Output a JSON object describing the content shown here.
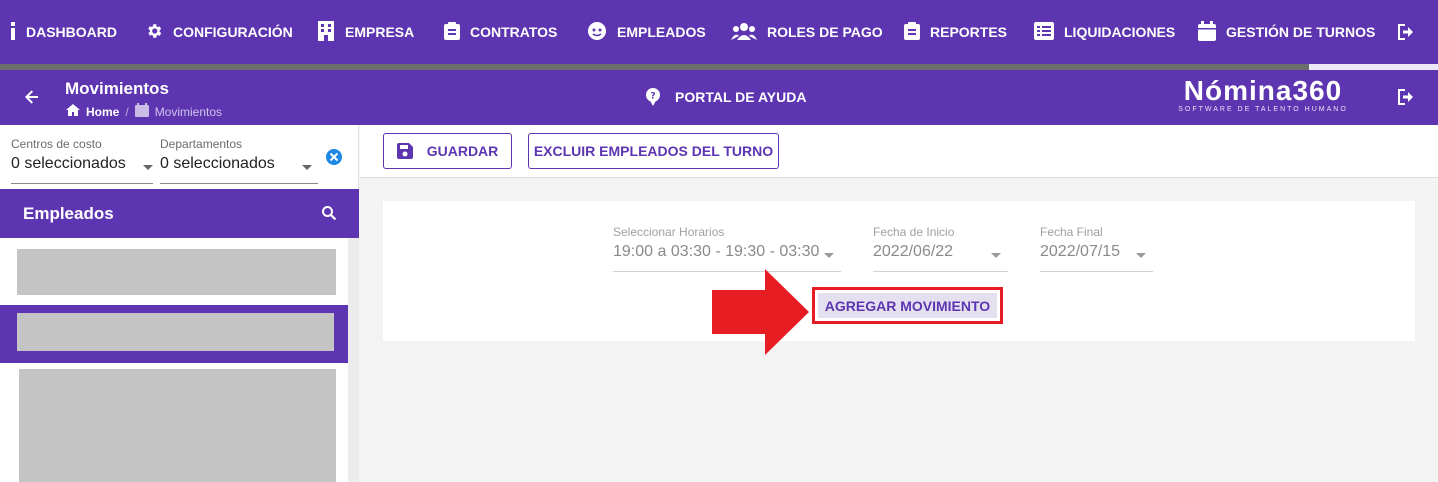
{
  "nav": {
    "items": [
      {
        "label": "DASHBOARD",
        "icon": "info-icon"
      },
      {
        "label": "CONFIGURACIÓN",
        "icon": "gear-icon"
      },
      {
        "label": "EMPRESA",
        "icon": "building-icon"
      },
      {
        "label": "CONTRATOS",
        "icon": "clipboard-icon"
      },
      {
        "label": "EMPLEADOS",
        "icon": "face-icon"
      },
      {
        "label": "ROLES DE PAGO",
        "icon": "people-icon"
      },
      {
        "label": "REPORTES",
        "icon": "clipboard-icon"
      },
      {
        "label": "LIQUIDACIONES",
        "icon": "list-icon"
      },
      {
        "label": "GESTIÓN DE TURNOS",
        "icon": "calendar-icon"
      }
    ],
    "logout_icon": "logout-icon",
    "progress_fraction": 0.91
  },
  "header": {
    "title": "Movimientos",
    "breadcrumb_home": "Home",
    "breadcrumb_sep": "/",
    "breadcrumb_current": "Movimientos",
    "help_label": "PORTAL DE AYUDA",
    "brand_name": "Nómina360",
    "brand_tagline": "SOFTWARE DE TALENTO HUMANO"
  },
  "sidebar": {
    "filters": [
      {
        "label": "Centros de costo",
        "value": "0 seleccionados"
      },
      {
        "label": "Departamentos",
        "value": "0 seleccionados"
      }
    ],
    "employees_title": "Empleados"
  },
  "toolbar": {
    "save_label": "GUARDAR",
    "exclude_label": "EXCLUIR EMPLEADOS DEL TURNO"
  },
  "form": {
    "schedule": {
      "label": "Seleccionar Horarios",
      "value": "19:00 a 03:30 - 19:30 - 03:30"
    },
    "start_date": {
      "label": "Fecha de Inicio",
      "value": "2022/06/22"
    },
    "end_date": {
      "label": "Fecha Final",
      "value": "2022/07/15"
    },
    "add_label": "AGREGAR MOVIMIENTO"
  },
  "colors": {
    "primary": "#5e35b1",
    "highlight": "#e81c23"
  }
}
